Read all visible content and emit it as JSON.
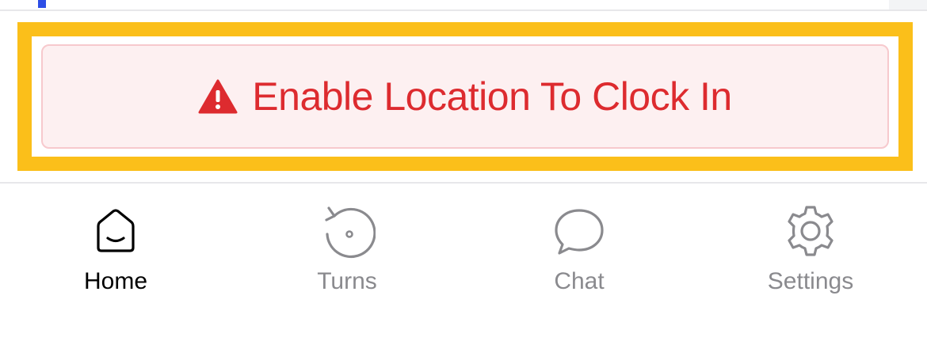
{
  "clock_in": {
    "label": "Enable Location To Clock In",
    "icon": "warning-triangle-icon",
    "color": "#dd2b2f",
    "background": "#fdf0f1",
    "highlight_color": "#fbbf1a"
  },
  "tabs": [
    {
      "label": "Home",
      "icon": "home-icon",
      "active": true
    },
    {
      "label": "Turns",
      "icon": "history-icon",
      "active": false
    },
    {
      "label": "Chat",
      "icon": "chat-bubble-icon",
      "active": false
    },
    {
      "label": "Settings",
      "icon": "gear-icon",
      "active": false
    }
  ],
  "colors": {
    "active_tab": "#000000",
    "inactive_tab": "#8a8a8e",
    "accent": "#2d4ee6"
  }
}
